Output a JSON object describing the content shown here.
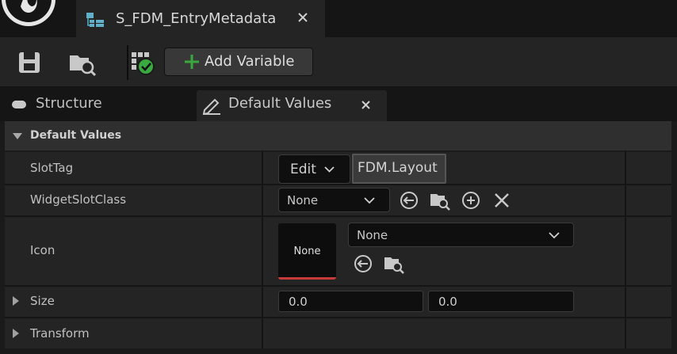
{
  "document_tab": {
    "title": "S_FDM_EntryMetadata"
  },
  "toolbar": {
    "add_variable_label": "Add Variable"
  },
  "panel_tabs": {
    "structure_label": "Structure",
    "default_values_label": "Default Values"
  },
  "details": {
    "section_title": "Default Values",
    "rows": {
      "slot_tag": {
        "name": "SlotTag",
        "edit_label": "Edit",
        "tag_value": "FDM.Layout"
      },
      "widget_slot_class": {
        "name": "WidgetSlotClass",
        "value": "None"
      },
      "icon": {
        "name": "Icon",
        "thumbnail_label": "None",
        "value": "None"
      },
      "size": {
        "name": "Size",
        "x": "0.0",
        "y": "0.0"
      },
      "transform": {
        "name": "Transform"
      }
    }
  },
  "colors": {
    "accent_green": "#3aa840",
    "thumbnail_underline": "#c83a3a",
    "panel_bg": "#242424",
    "header_bg": "#2f2f2f"
  },
  "icons": [
    "unreal-logo-icon",
    "structure-asset-icon",
    "close-icon",
    "save-icon",
    "browse-icon",
    "validate-check-icon",
    "plus-icon",
    "pencil-icon",
    "chevron-down-icon",
    "use-selected-icon",
    "add-icon",
    "clear-icon",
    "expand-arrow-icon"
  ]
}
